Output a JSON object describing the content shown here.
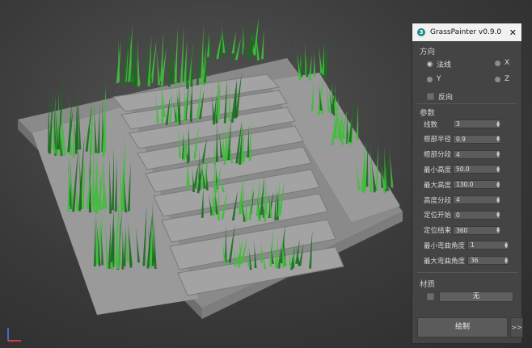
{
  "panel": {
    "title": "GrassPainter v0.9.0",
    "logo_text": "3",
    "close_glyph": "✕",
    "direction": {
      "label": "方向",
      "options": [
        "法线",
        "X",
        "Y",
        "Z"
      ],
      "selected": "法线",
      "reverse_label": "反向"
    },
    "params": {
      "label": "参数",
      "fields": [
        {
          "label": "线数",
          "value": "3"
        },
        {
          "label": "根部半径",
          "value": "0.9"
        },
        {
          "label": "根部分段",
          "value": "4"
        },
        {
          "label": "最小高度",
          "value": "50.0"
        },
        {
          "label": "最大高度",
          "value": "130.0"
        },
        {
          "label": "高度分段",
          "value": "4"
        },
        {
          "label": "定位开始",
          "value": "0"
        },
        {
          "label": "定位结束",
          "value": "360"
        },
        {
          "label": "最小弯曲角度",
          "value": "1"
        },
        {
          "label": "最大弯曲角度",
          "value": "36"
        }
      ]
    },
    "material": {
      "label": "材质",
      "button": "无"
    },
    "draw_button": "绘制",
    "more_button": ">>"
  },
  "colors": {
    "grass_dark": "#1b6e1f",
    "grass_light": "#3fbf3a",
    "stone": "#8f8f8f",
    "background": "#3a3a3a"
  }
}
